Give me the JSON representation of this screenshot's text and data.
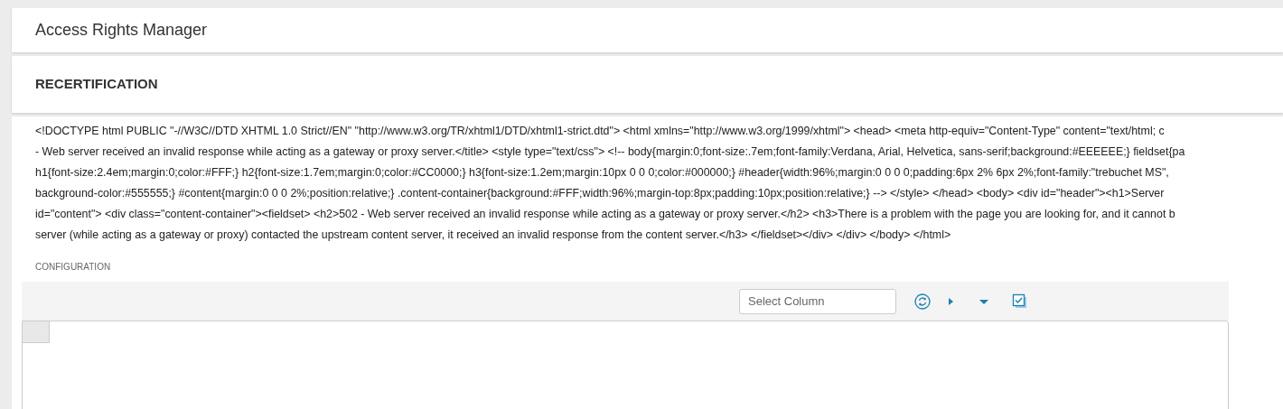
{
  "app_title": "Access Rights Manager",
  "section_title": "RECERTIFICATION",
  "response_lines": [
    "<!DOCTYPE html PUBLIC \"-//W3C//DTD XHTML 1.0 Strict//EN\" \"http://www.w3.org/TR/xhtml1/DTD/xhtml1-strict.dtd\"> <html xmlns=\"http://www.w3.org/1999/xhtml\"> <head> <meta http-equiv=\"Content-Type\" content=\"text/html; c",
    "- Web server received an invalid response while acting as a gateway or proxy server.</title> <style type=\"text/css\"> <!-- body{margin:0;font-size:.7em;font-family:Verdana, Arial, Helvetica, sans-serif;background:#EEEEEE;} fieldset{pa",
    "h1{font-size:2.4em;margin:0;color:#FFF;} h2{font-size:1.7em;margin:0;color:#CC0000;} h3{font-size:1.2em;margin:10px 0 0 0;color:#000000;} #header{width:96%;margin:0 0 0 0;padding:6px 2% 6px 2%;font-family:\"trebuchet MS\",",
    "background-color:#555555;} #content{margin:0 0 0 2%;position:relative;} .content-container{background:#FFF;width:96%;margin-top:8px;padding:10px;position:relative;} --> </style> </head> <body> <div id=\"header\"><h1>Server",
    "id=\"content\"> <div class=\"content-container\"><fieldset> <h2>502 - Web server received an invalid response while acting as a gateway or proxy server.</h2> <h3>There is a problem with the page you are looking for, and it cannot b",
    "server (while acting as a gateway or proxy) contacted the upstream content server, it received an invalid response from the content server.</h3> </fieldset></div> </div> </body> </html>"
  ],
  "configuration": {
    "label": "CONFIGURATION",
    "select_column": {
      "placeholder": "Select Column"
    }
  }
}
